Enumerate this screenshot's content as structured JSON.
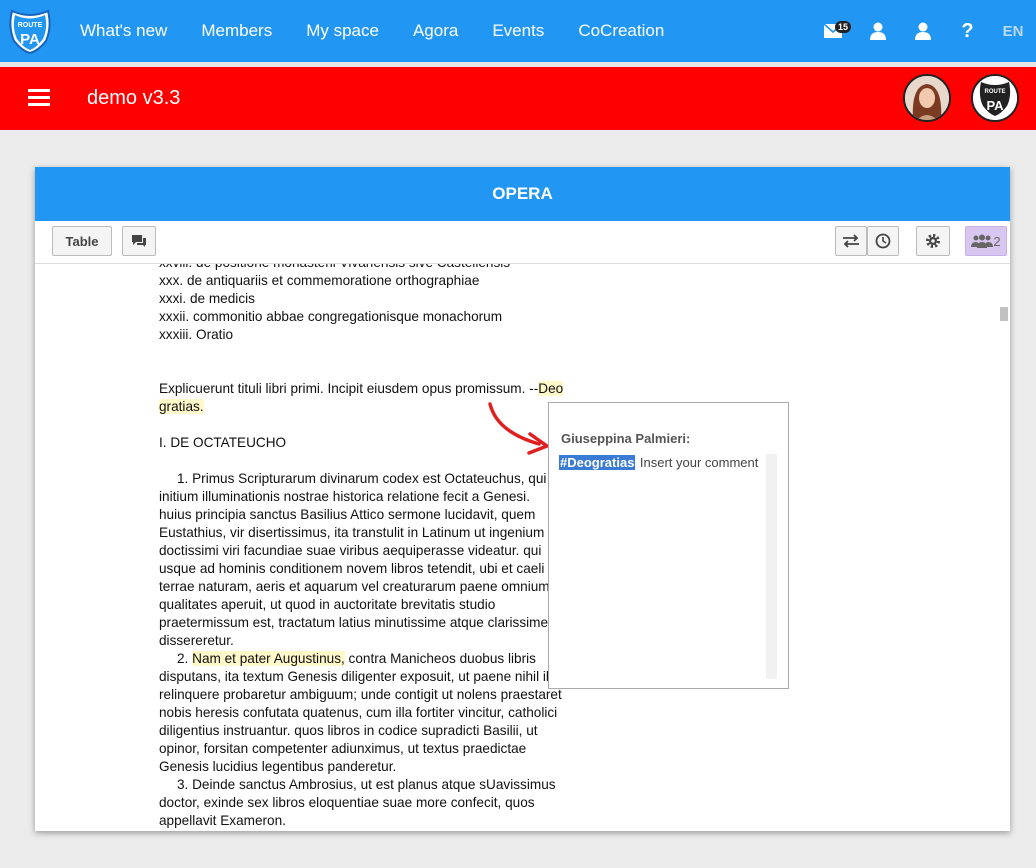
{
  "nav": {
    "logo_alt": "Route to PA",
    "links": [
      "What's new",
      "Members",
      "My space",
      "Agora",
      "Events",
      "CoCreation"
    ],
    "mail_badge": "15",
    "help": "?",
    "lang": "EN"
  },
  "header": {
    "title": "demo v3.3"
  },
  "card": {
    "title": "OPERA"
  },
  "toolbar": {
    "table_label": "Table",
    "users_count": "2"
  },
  "doc": {
    "lines_top": [
      "xxviii. de positione monasterii Vivariensis sive Castellensis",
      "xxx. de antiquariis et commemoratione orthographiae",
      "xxxi. de medicis",
      "xxxii. commonitio abbae congregationisque monachorum",
      "xxxiii. Oratio"
    ],
    "explicit_pre": "Explicuerunt tituli libri primi.  Incipit eiusdem opus promissum.  --",
    "explicit_hl_1": "Deo",
    "explicit_hl_2": "gratias.",
    "section": "I. DE OCTATEUCHO",
    "p1": [
      "1.  Primus Scripturarum divinarum codex est Octateuchus, qui",
      "initium illuminationis nostrae historica relatione fecit a Genesi.",
      "huius principia sanctus Basilius Attico sermone lucidavit, quem",
      "Eustathius, vir disertissimus, ita transtulit in Latinum ut ingenium",
      "doctissimi viri facundiae suae viribus aequiperasse videatur.  qui",
      "usque ad hominis conditionem novem libros tetendit, ubi et caeli et",
      "terrae naturam, aeris et aquarum vel creaturarum paene omnium",
      "qualitates aperuit, ut quod in auctoritate brevitatis studio",
      "praetermissum est, tractatum latius minutissime atque clarissime",
      "dissereretur."
    ],
    "p2_num": "2. ",
    "p2_hl": "Nam et pater Augustinus,",
    "p2_first_rest": " contra Manicheos duobus libris",
    "p2": [
      "disputans, ita textum Genesis diligenter exposuit, ut paene nihil ibi",
      "relinquere probaretur ambiguum; unde contigit ut nolens praestaret",
      "nobis heresis confutata quatenus, cum illa fortiter vincitur, catholici",
      "diligentius instruantur. quos libros in codice supradicti Basilii, ut",
      "opinor, forsitan competenter adiunximus, ut textus praedictae",
      "Genesis lucidius legentibus panderetur."
    ],
    "p3": [
      "3.  Deinde sanctus Ambrosius, ut est planus atque sUavissimus",
      "doctor, exinde sex libros eloquentiae suae more confecit, quos",
      "appellavit Exameron."
    ]
  },
  "comment": {
    "author": "Giuseppina Palmieri:",
    "tag": "#Deogratias",
    "placeholder": "Insert your comment"
  },
  "colors": {
    "nav_blue": "#2196f3",
    "header_red": "#ff0000",
    "highlight": "#fff8c8",
    "arrow": "#e02020"
  }
}
